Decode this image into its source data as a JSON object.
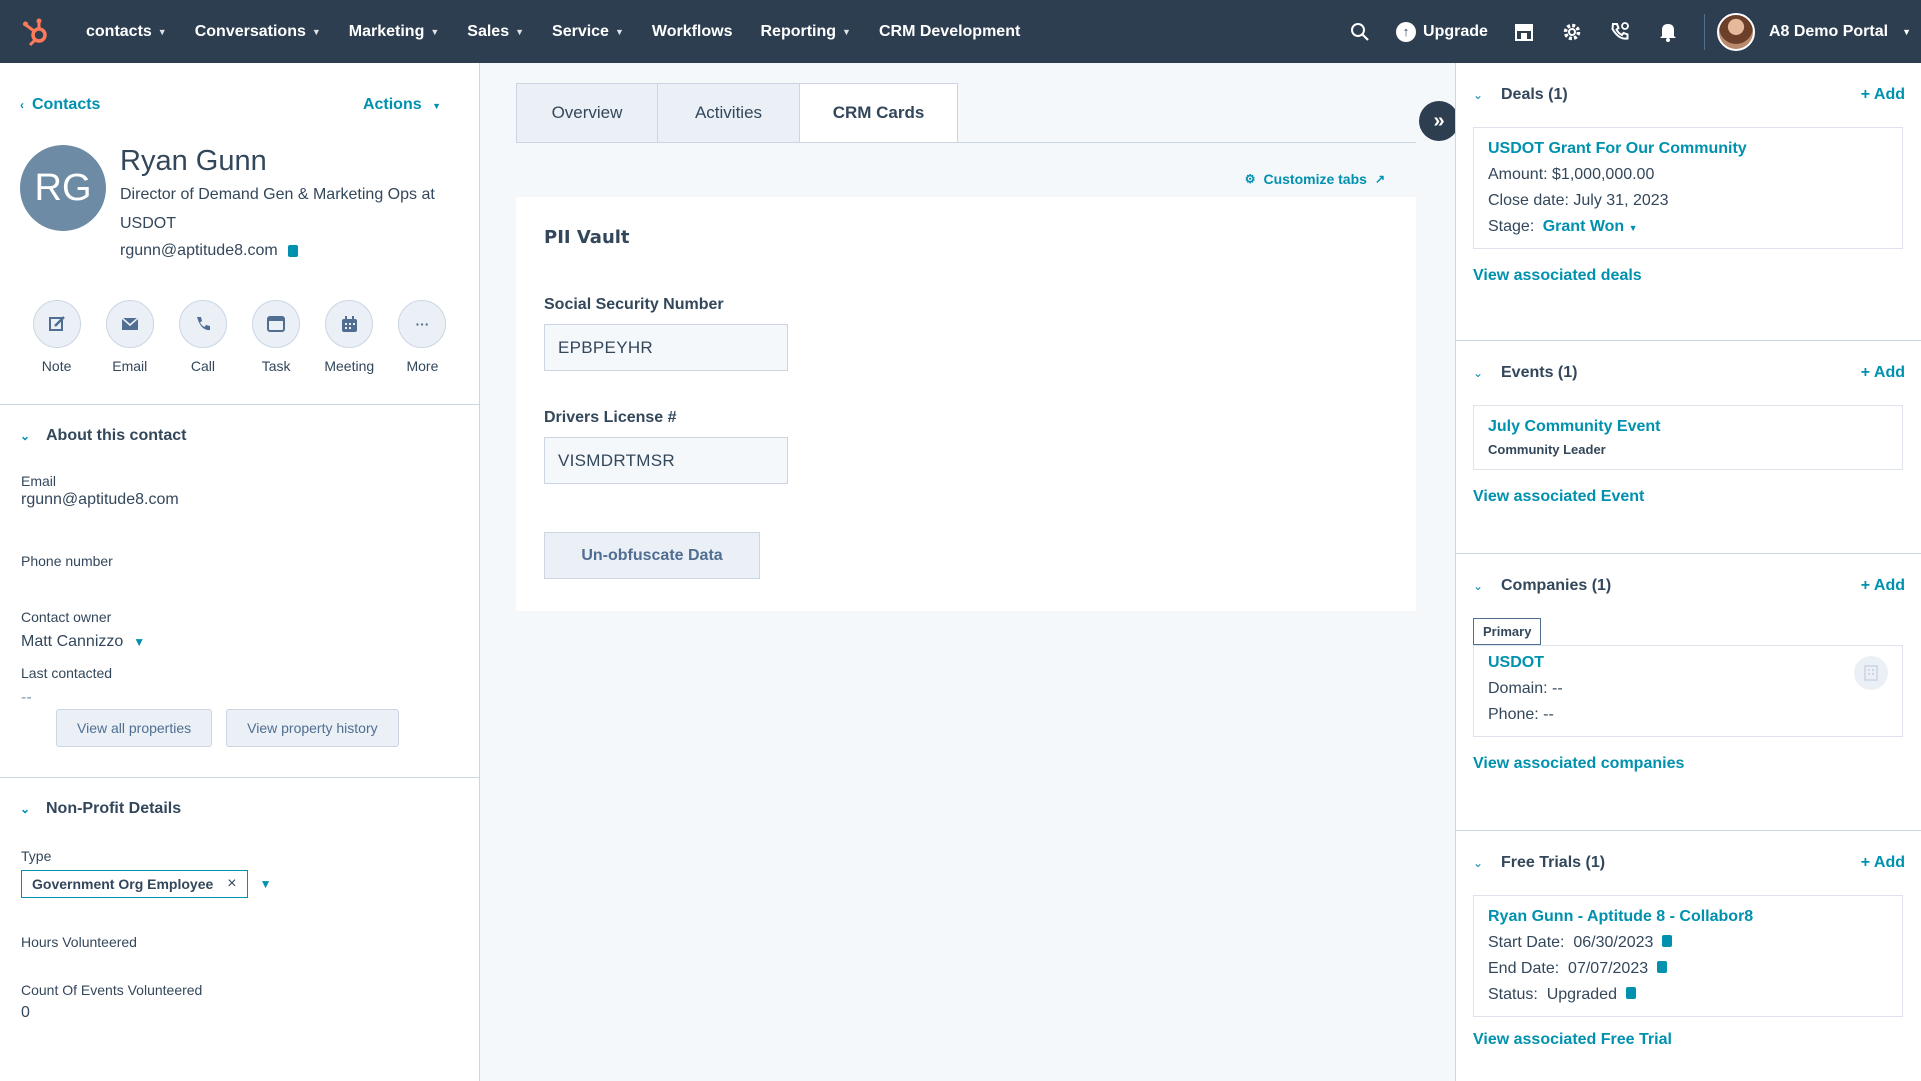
{
  "nav": {
    "items": [
      {
        "label": "contacts",
        "caret": true
      },
      {
        "label": "Conversations",
        "caret": true
      },
      {
        "label": "Marketing",
        "caret": true
      },
      {
        "label": "Sales",
        "caret": true
      },
      {
        "label": "Service",
        "caret": true
      },
      {
        "label": "Workflows",
        "caret": false
      },
      {
        "label": "Reporting",
        "caret": true
      },
      {
        "label": "CRM Development",
        "caret": false
      }
    ],
    "upgrade_label": "Upgrade",
    "portal_label": "A8 Demo Portal",
    "brand_color": "#2d3e50",
    "logo_color": "#ff7a59"
  },
  "left": {
    "back_label": "Contacts",
    "actions_label": "Actions",
    "avatar_initials": "RG",
    "name": "Ryan Gunn",
    "title": "Director of Demand Gen & Marketing Ops at USDOT",
    "email": "rgunn@aptitude8.com",
    "quick_actions": [
      {
        "label": "Note",
        "icon": "edit-icon"
      },
      {
        "label": "Email",
        "icon": "envelope-icon"
      },
      {
        "label": "Call",
        "icon": "phone-icon"
      },
      {
        "label": "Task",
        "icon": "task-icon"
      },
      {
        "label": "Meeting",
        "icon": "calendar-icon"
      },
      {
        "label": "More",
        "icon": "more-icon"
      }
    ],
    "about": {
      "heading": "About this contact",
      "email_label": "Email",
      "email_value": "rgunn@aptitude8.com",
      "phone_label": "Phone number",
      "owner_label": "Contact owner",
      "owner_value": "Matt Cannizzo",
      "last_contacted_label": "Last contacted",
      "last_contacted_value": "--",
      "view_all_label": "View all properties",
      "view_history_label": "View property history"
    },
    "nonprofit": {
      "heading": "Non-Profit Details",
      "type_label": "Type",
      "type_tag": "Government Org Employee",
      "hours_label": "Hours Volunteered",
      "count_label": "Count Of Events Volunteered",
      "count_value": "0"
    }
  },
  "middle": {
    "tabs": [
      "Overview",
      "Activities",
      "CRM Cards"
    ],
    "active_tab": "CRM Cards",
    "customize_label": "Customize tabs",
    "card": {
      "title": "PII Vault",
      "ssn_label": "Social Security Number",
      "ssn_value": "EPBPEYHR",
      "dl_label": "Drivers License #",
      "dl_value": "VISMDRTMSR",
      "button_label": "Un-obfuscate Data"
    }
  },
  "right": {
    "add_label": "+ Add",
    "deals": {
      "title": "Deals (1)",
      "name": "USDOT Grant For Our Community",
      "amount": "Amount: $1,000,000.00",
      "close_date": "Close date: July 31, 2023",
      "stage_label": "Stage:",
      "stage_value": "Grant Won",
      "view_label": "View associated deals"
    },
    "events": {
      "title": "Events (1)",
      "name": "July Community Event",
      "sub": "Community Leader",
      "view_label": "View associated Event"
    },
    "companies": {
      "title": "Companies (1)",
      "primary_label": "Primary",
      "name": "USDOT",
      "domain": "Domain: --",
      "phone": "Phone: --",
      "view_label": "View associated companies"
    },
    "trials": {
      "title": "Free Trials (1)",
      "name": "Ryan Gunn - Aptitude 8 - Collabor8",
      "start": "Start Date:  06/30/2023",
      "end": "End Date:  07/07/2023",
      "status": "Status:  Upgraded",
      "view_label": "View associated Free Trial"
    }
  }
}
